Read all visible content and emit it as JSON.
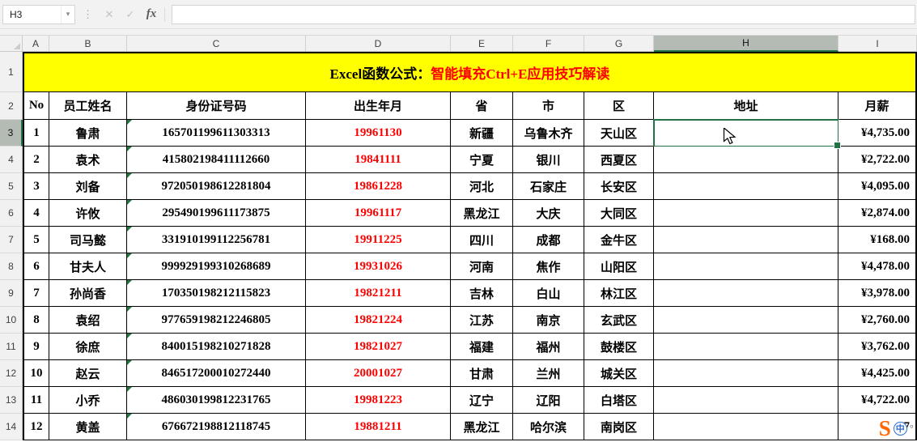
{
  "toolbar": {
    "name_box": "H3",
    "dropdown_icon": "▾",
    "dots_icon": "⋮",
    "cancel_label": "✕",
    "enter_label": "✓",
    "fx_label": "fx"
  },
  "sheet": {
    "column_letters": [
      "A",
      "B",
      "C",
      "D",
      "E",
      "F",
      "G",
      "H",
      "I"
    ],
    "selection": {
      "cell": "H3",
      "column": "H",
      "row": 3
    },
    "title": {
      "black_part": "Excel函数公式：",
      "red_part": "智能填充Ctrl+E应用技巧解读"
    },
    "header_row": [
      "No",
      "员工姓名",
      "身份证号码",
      "出生年月",
      "省",
      "市",
      "区",
      "地址",
      "月薪"
    ],
    "rows": [
      {
        "no": "1",
        "name": "鲁肃",
        "id": "165701199611303313",
        "birth": "19961130",
        "province": "新疆",
        "city": "乌鲁木齐",
        "district": "天山区",
        "address": "",
        "salary": "¥4,735.00"
      },
      {
        "no": "2",
        "name": "袁术",
        "id": "415802198411112660",
        "birth": "19841111",
        "province": "宁夏",
        "city": "银川",
        "district": "西夏区",
        "address": "",
        "salary": "¥2,722.00"
      },
      {
        "no": "3",
        "name": "刘备",
        "id": "972050198612281804",
        "birth": "19861228",
        "province": "河北",
        "city": "石家庄",
        "district": "长安区",
        "address": "",
        "salary": "¥4,095.00"
      },
      {
        "no": "4",
        "name": "许攸",
        "id": "295490199611173875",
        "birth": "19961117",
        "province": "黑龙江",
        "city": "大庆",
        "district": "大同区",
        "address": "",
        "salary": "¥2,874.00"
      },
      {
        "no": "5",
        "name": "司马懿",
        "id": "331910199112256781",
        "birth": "19911225",
        "province": "四川",
        "city": "成都",
        "district": "金牛区",
        "address": "",
        "salary": "¥168.00"
      },
      {
        "no": "6",
        "name": "甘夫人",
        "id": "999929199310268689",
        "birth": "19931026",
        "province": "河南",
        "city": "焦作",
        "district": "山阳区",
        "address": "",
        "salary": "¥4,478.00"
      },
      {
        "no": "7",
        "name": "孙尚香",
        "id": "170350198212115823",
        "birth": "19821211",
        "province": "吉林",
        "city": "白山",
        "district": "林江区",
        "address": "",
        "salary": "¥3,978.00"
      },
      {
        "no": "8",
        "name": "袁绍",
        "id": "977659198212246805",
        "birth": "19821224",
        "province": "江苏",
        "city": "南京",
        "district": "玄武区",
        "address": "",
        "salary": "¥2,760.00"
      },
      {
        "no": "9",
        "name": "徐庶",
        "id": "840015198210271828",
        "birth": "19821027",
        "province": "福建",
        "city": "福州",
        "district": "鼓楼区",
        "address": "",
        "salary": "¥3,762.00"
      },
      {
        "no": "10",
        "name": "赵云",
        "id": "846517200010272440",
        "birth": "20001027",
        "province": "甘肃",
        "city": "兰州",
        "district": "城关区",
        "address": "",
        "salary": "¥4,425.00"
      },
      {
        "no": "11",
        "name": "小乔",
        "id": "486030199812231765",
        "birth": "19981223",
        "province": "辽宁",
        "city": "辽阳",
        "district": "白塔区",
        "address": "",
        "salary": "¥4,722.00"
      },
      {
        "no": "12",
        "name": "黄盖",
        "id": "676672198812118745",
        "birth": "19881211",
        "province": "黑龙江",
        "city": "哈尔滨",
        "district": "南岗区",
        "address": "",
        "salary": "¥7"
      }
    ]
  },
  "colors": {
    "banner_bg": "#FFFF00",
    "banner_red_text": "#FF0000",
    "birth_red_text": "#FF0000",
    "selection_green": "#217346",
    "selected_header_bg": "#B4BAB4",
    "error_triangle_green": "#1F7A3F",
    "ime_orange": "#FF6600",
    "ime_blue": "#2E6FD0"
  },
  "ime": {
    "logo": "S",
    "mode": "中",
    "dot": "°"
  }
}
